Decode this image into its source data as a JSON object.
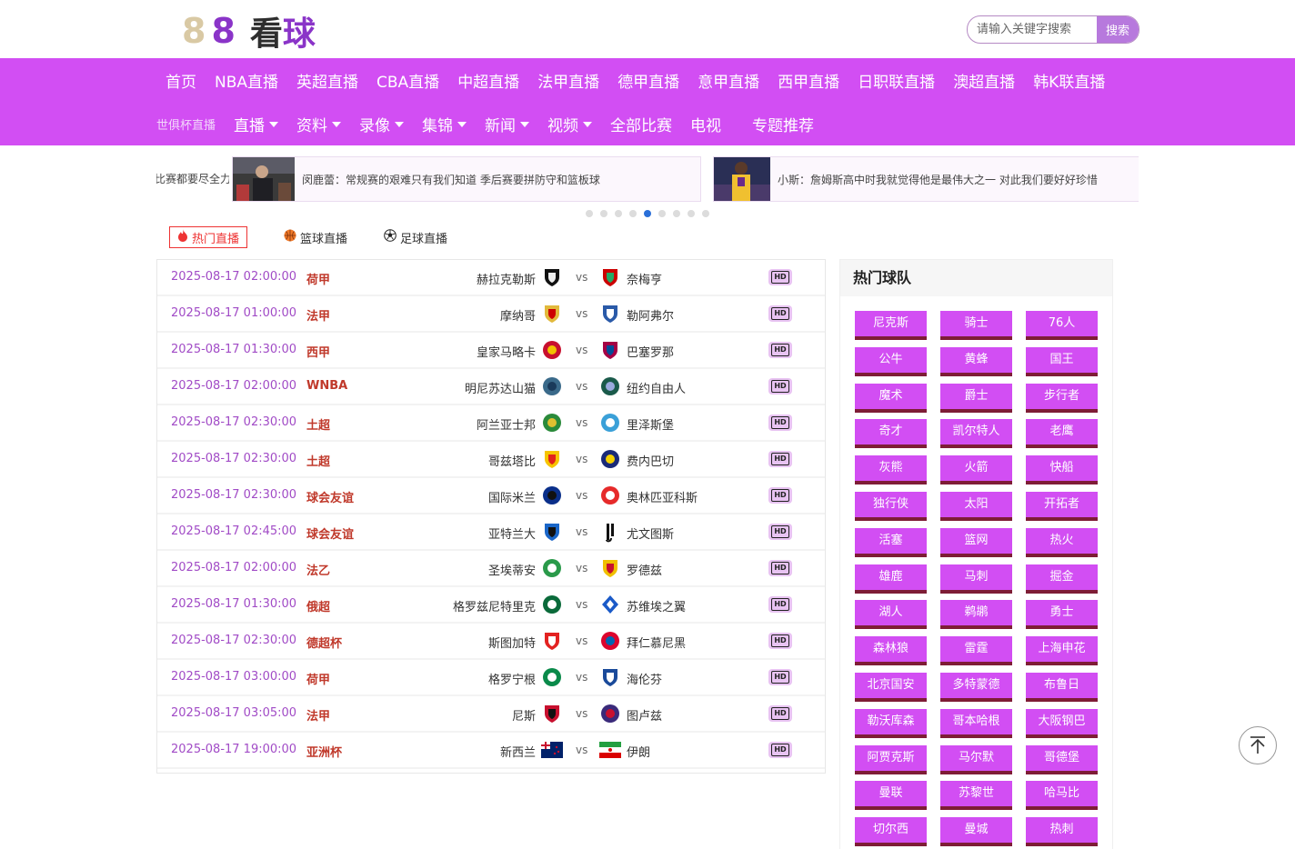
{
  "logo": {
    "digit1": "8",
    "digit2": "8",
    "text1": "看",
    "text2": "球"
  },
  "search": {
    "placeholder": "请输入关键字搜索",
    "button": "搜索"
  },
  "nav_row1": [
    "首页",
    "NBA直播",
    "英超直播",
    "CBA直播",
    "中超直播",
    "法甲直播",
    "德甲直播",
    "意甲直播",
    "西甲直播",
    "日职联直播",
    "澳超直播",
    "韩K联直播"
  ],
  "nav_row2": {
    "small": "世俱杯直播",
    "items": [
      {
        "label": "直播",
        "dropdown": true
      },
      {
        "label": "资料",
        "dropdown": true
      },
      {
        "label": "录像",
        "dropdown": true
      },
      {
        "label": "集锦",
        "dropdown": true
      },
      {
        "label": "新闻",
        "dropdown": true
      },
      {
        "label": "视频",
        "dropdown": true
      },
      {
        "label": "全部比赛",
        "dropdown": false
      },
      {
        "label": "电视",
        "dropdown": false
      },
      {
        "label": "专题推荐",
        "dropdown": false
      }
    ]
  },
  "news": [
    {
      "text": "比赛都要尽全力"
    },
    {
      "text": "闵鹿蕾：常规赛的艰难只有我们知道 季后赛要拼防守和篮板球"
    },
    {
      "text": "小斯：詹姆斯高中时我就觉得他是最伟大之一 对此我们要好好珍惜"
    }
  ],
  "carousel": {
    "dot_count": 9,
    "active_index": 4
  },
  "tabs": [
    {
      "label": "热门直播",
      "icon": "fire-icon",
      "active": true
    },
    {
      "label": "篮球直播",
      "icon": "basketball-icon",
      "active": false
    },
    {
      "label": "足球直播",
      "icon": "soccer-ball-icon",
      "active": false
    }
  ],
  "vs_text": "vs",
  "hd_text": "HD",
  "matches": [
    {
      "time": "2025-08-17 02:00:00",
      "league": "荷甲",
      "home": "赫拉克勒斯",
      "away": "奈梅亨"
    },
    {
      "time": "2025-08-17 01:00:00",
      "league": "法甲",
      "home": "摩纳哥",
      "away": "勒阿弗尔"
    },
    {
      "time": "2025-08-17 01:30:00",
      "league": "西甲",
      "home": "皇家马略卡",
      "away": "巴塞罗那"
    },
    {
      "time": "2025-08-17 02:00:00",
      "league": "WNBA",
      "home": "明尼苏达山猫",
      "away": "纽约自由人"
    },
    {
      "time": "2025-08-17 02:30:00",
      "league": "土超",
      "home": "阿兰亚士邦",
      "away": "里泽斯堡"
    },
    {
      "time": "2025-08-17 02:30:00",
      "league": "土超",
      "home": "哥兹塔比",
      "away": "费内巴切"
    },
    {
      "time": "2025-08-17 02:30:00",
      "league": "球会友谊",
      "home": "国际米兰",
      "away": "奥林匹亚科斯"
    },
    {
      "time": "2025-08-17 02:45:00",
      "league": "球会友谊",
      "home": "亚特兰大",
      "away": "尤文图斯"
    },
    {
      "time": "2025-08-17 02:00:00",
      "league": "法乙",
      "home": "圣埃蒂安",
      "away": "罗德兹"
    },
    {
      "time": "2025-08-17 01:30:00",
      "league": "俄超",
      "home": "格罗兹尼特里克",
      "away": "苏维埃之翼"
    },
    {
      "time": "2025-08-17 02:30:00",
      "league": "德超杯",
      "home": "斯图加特",
      "away": "拜仁慕尼黑"
    },
    {
      "time": "2025-08-17 03:00:00",
      "league": "荷甲",
      "home": "格罗宁根",
      "away": "海伦芬"
    },
    {
      "time": "2025-08-17 03:05:00",
      "league": "法甲",
      "home": "尼斯",
      "away": "图卢兹"
    },
    {
      "time": "2025-08-17 19:00:00",
      "league": "亚洲杯",
      "home": "新西兰",
      "away": "伊朗"
    }
  ],
  "hot_teams": {
    "title": "热门球队",
    "teams": [
      "尼克斯",
      "骑士",
      "76人",
      "公牛",
      "黄蜂",
      "国王",
      "魔术",
      "爵士",
      "步行者",
      "奇才",
      "凯尔特人",
      "老鹰",
      "灰熊",
      "火箭",
      "快船",
      "独行侠",
      "太阳",
      "开拓者",
      "活塞",
      "篮网",
      "热火",
      "雄鹿",
      "马刺",
      "掘金",
      "湖人",
      "鹈鹕",
      "勇士",
      "森林狼",
      "雷霆",
      "上海申花",
      "北京国安",
      "多特蒙德",
      "布鲁日",
      "勒沃库森",
      "哥本哈根",
      "大阪钢巴",
      "阿贾克斯",
      "马尔默",
      "哥德堡",
      "曼联",
      "苏黎世",
      "哈马比",
      "切尔西",
      "曼城",
      "热刺"
    ]
  },
  "colors": {
    "nav_bg": "#d24ef3",
    "team_btn": "#d24ef3",
    "team_btn_shadow": "#7e1d36",
    "time_text": "#a14bc6",
    "league_text": "#c0392b"
  }
}
